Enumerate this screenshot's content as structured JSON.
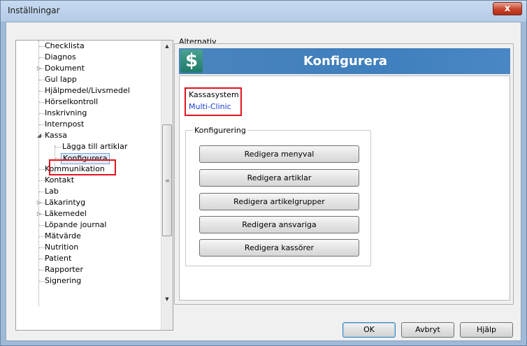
{
  "window": {
    "title": "Inställningar",
    "close_glyph": "x"
  },
  "tree": {
    "items": [
      {
        "label": "Checklista"
      },
      {
        "label": "Diagnos"
      },
      {
        "label": "Dokument",
        "expander": "▷"
      },
      {
        "label": "Gul lapp"
      },
      {
        "label": "Hjälpmedel/Livsmedel"
      },
      {
        "label": "Hörselkontroll"
      },
      {
        "label": "Inskrivning"
      },
      {
        "label": "Internpost"
      },
      {
        "label": "Kassa",
        "expander": "◢"
      },
      {
        "label": "Lägga till artiklar"
      },
      {
        "label": "Konfigurera"
      },
      {
        "label": "Kommunikation"
      },
      {
        "label": "Kontakt"
      },
      {
        "label": "Lab"
      },
      {
        "label": "Läkarintyg",
        "expander": "▷"
      },
      {
        "label": "Läkemedel",
        "expander": "▷"
      },
      {
        "label": "Löpande journal"
      },
      {
        "label": "Mätvärde"
      },
      {
        "label": "Nutrition"
      },
      {
        "label": "Patient"
      },
      {
        "label": "Rapporter"
      },
      {
        "label": "Signering"
      }
    ],
    "scroll_up": "▲",
    "scroll_down": "▼",
    "grip": "≡"
  },
  "alternativ": {
    "group_label": "Alternativ",
    "banner_logo": "$",
    "banner_title": "Konfigurera",
    "kassasystem_label": "Kassasystem",
    "kassasystem_value": "Multi-Clinic",
    "konfigurering_label": "Konfigurering",
    "buttons": [
      "Redigera menyval",
      "Redigera artiklar",
      "Redigera artikelgrupper",
      "Redigera ansvariga",
      "Redigera kassörer"
    ]
  },
  "footer": {
    "ok": "OK",
    "cancel": "Avbryt",
    "help": "Hjälp"
  },
  "colors": {
    "highlight": "#e0141e",
    "banner": "#3f7fbd",
    "link": "#1a3fd6"
  }
}
